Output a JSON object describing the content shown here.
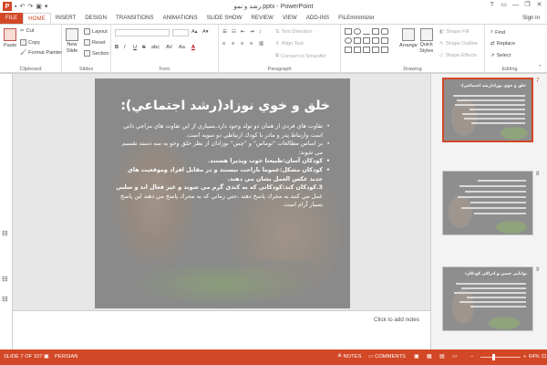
{
  "window": {
    "title": "رشد و نمو.pptx - PowerPoint",
    "controls": [
      "?",
      "▭",
      "—",
      "❐",
      "✕"
    ]
  },
  "tabs": [
    {
      "label": "FILE"
    },
    {
      "label": "HOME"
    },
    {
      "label": "INSERT"
    },
    {
      "label": "DESIGN"
    },
    {
      "label": "TRANSITIONS"
    },
    {
      "label": "ANIMATIONS"
    },
    {
      "label": "SLIDE SHOW"
    },
    {
      "label": "REVIEW"
    },
    {
      "label": "VIEW"
    },
    {
      "label": "ADD-INS"
    },
    {
      "label": "FILEminimizer"
    }
  ],
  "signin": "Sign in",
  "ribbon": {
    "clipboard": {
      "label": "Clipboard",
      "paste": "Paste",
      "cut": "Cut",
      "copy": "Copy",
      "format_painter": "Format Painter"
    },
    "slides": {
      "label": "Slides",
      "new_slide_1": "New",
      "new_slide_2": "Slide",
      "layout": "Layout",
      "reset": "Reset",
      "section": "Section"
    },
    "font": {
      "label": "Font",
      "bold": "B",
      "italic": "I",
      "underline": "U",
      "strike": "S",
      "shadow": "abc",
      "spacing": "AV",
      "case": "Aa",
      "color": "A"
    },
    "paragraph": {
      "label": "Paragraph",
      "text_direction": "Text Direction",
      "align_text": "Align Text",
      "smartart": "Convert to SmartArt"
    },
    "drawing": {
      "label": "Drawing",
      "arrange": "Arrange",
      "quick_styles_1": "Quick",
      "quick_styles_2": "Styles",
      "shape_fill": "Shape Fill",
      "shape_outline": "Shape Outline",
      "shape_effects": "Shape Effects"
    },
    "editing": {
      "label": "Editing",
      "find": "Find",
      "replace": "Replace",
      "select": "Select"
    }
  },
  "slide": {
    "title": "خلق و خوي نوزاد(رشد اجتماعي):",
    "bullets": [
      {
        "text": "تفاوت هاي فردي از همان دو تولد وجود دارد.بسياري از اين تفاوت هاي مزاجي ذاتي است وارتباط پدر و مادر با كودك ارتباطي دو سويه است.",
        "style": "normal"
      },
      {
        "text": "بر اساس مطالعات \"توماس\" و \"چس\" نوزادان از نظر خلق وخو به سه دسته تقسيم مي شوند:",
        "style": "normal"
      },
      {
        "text": "كودكان آسان:طبيعتا خوب وپذيرا هستند.",
        "style": "bold"
      },
      {
        "text": "كودكان مشكل:عموما ناراحت نيستند و در مقابل افراد وموقعيت هاي جديد عكس العمل نشان مي دهند.",
        "style": "bold"
      },
      {
        "text": "3.كودكان كند:كودكاني كه به كندي گرم مي شوند و غير فعال اند و سلبي",
        "style": "bold"
      },
      {
        "text": "عمل مي كنند.به محرك پاسخ دهند ،حتي زماني كه به محرك پاسخ مي دهند اين پاسخ بسيار آرام است.",
        "style": "normal"
      }
    ]
  },
  "notes_placeholder": "Click to add notes",
  "thumbnails": [
    {
      "number": "7",
      "title": "خلق و خوي نوزاد(رشد اجتماعي):",
      "active": true
    },
    {
      "number": "8",
      "title": "",
      "active": false
    },
    {
      "number": "9",
      "title": "توانايي حسي و ادراكي كودكان:",
      "active": false
    }
  ],
  "status": {
    "slide_count": "SLIDE 7 OF 107",
    "language": "PERSIAN",
    "notes": "NOTES",
    "comments": "COMMENTS",
    "zoom": "64%",
    "zoom_level": 0.64
  },
  "colors": {
    "accent": "#d24726",
    "slide_bg": "#8a8a8a"
  }
}
